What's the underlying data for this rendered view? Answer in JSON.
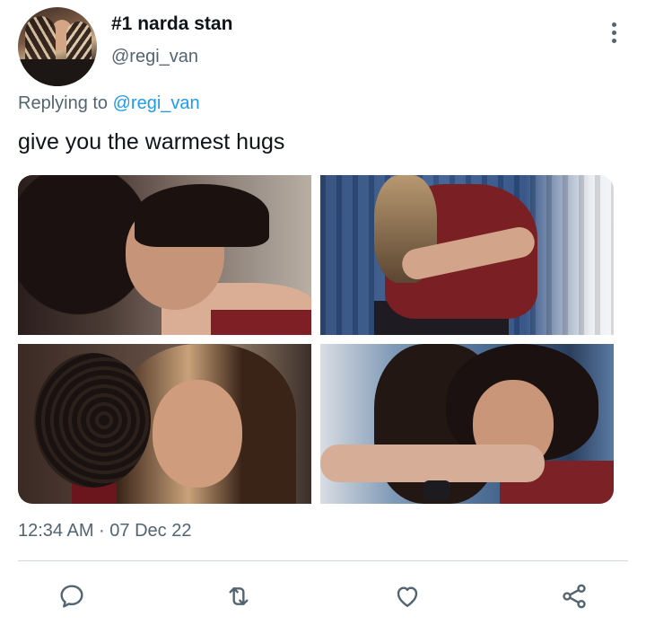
{
  "tweet": {
    "display_name": "#1 narda stan",
    "handle": "@regi_van",
    "replying_prefix": "Replying to",
    "replying_to": "@regi_van",
    "text": "give you the warmest hugs",
    "timestamp": "12:34 AM · 07 Dec 22"
  },
  "media": {
    "count": 4
  },
  "actions": [
    {
      "name": "reply",
      "icon": "speech-bubble-icon"
    },
    {
      "name": "retweet",
      "icon": "retweet-arrows-icon"
    },
    {
      "name": "like",
      "icon": "heart-icon"
    },
    {
      "name": "share",
      "icon": "share-nodes-icon"
    }
  ],
  "colors": {
    "text_primary": "#0f1419",
    "text_secondary": "#536471",
    "link": "#1d9bf0",
    "divider": "#cfd9de"
  }
}
